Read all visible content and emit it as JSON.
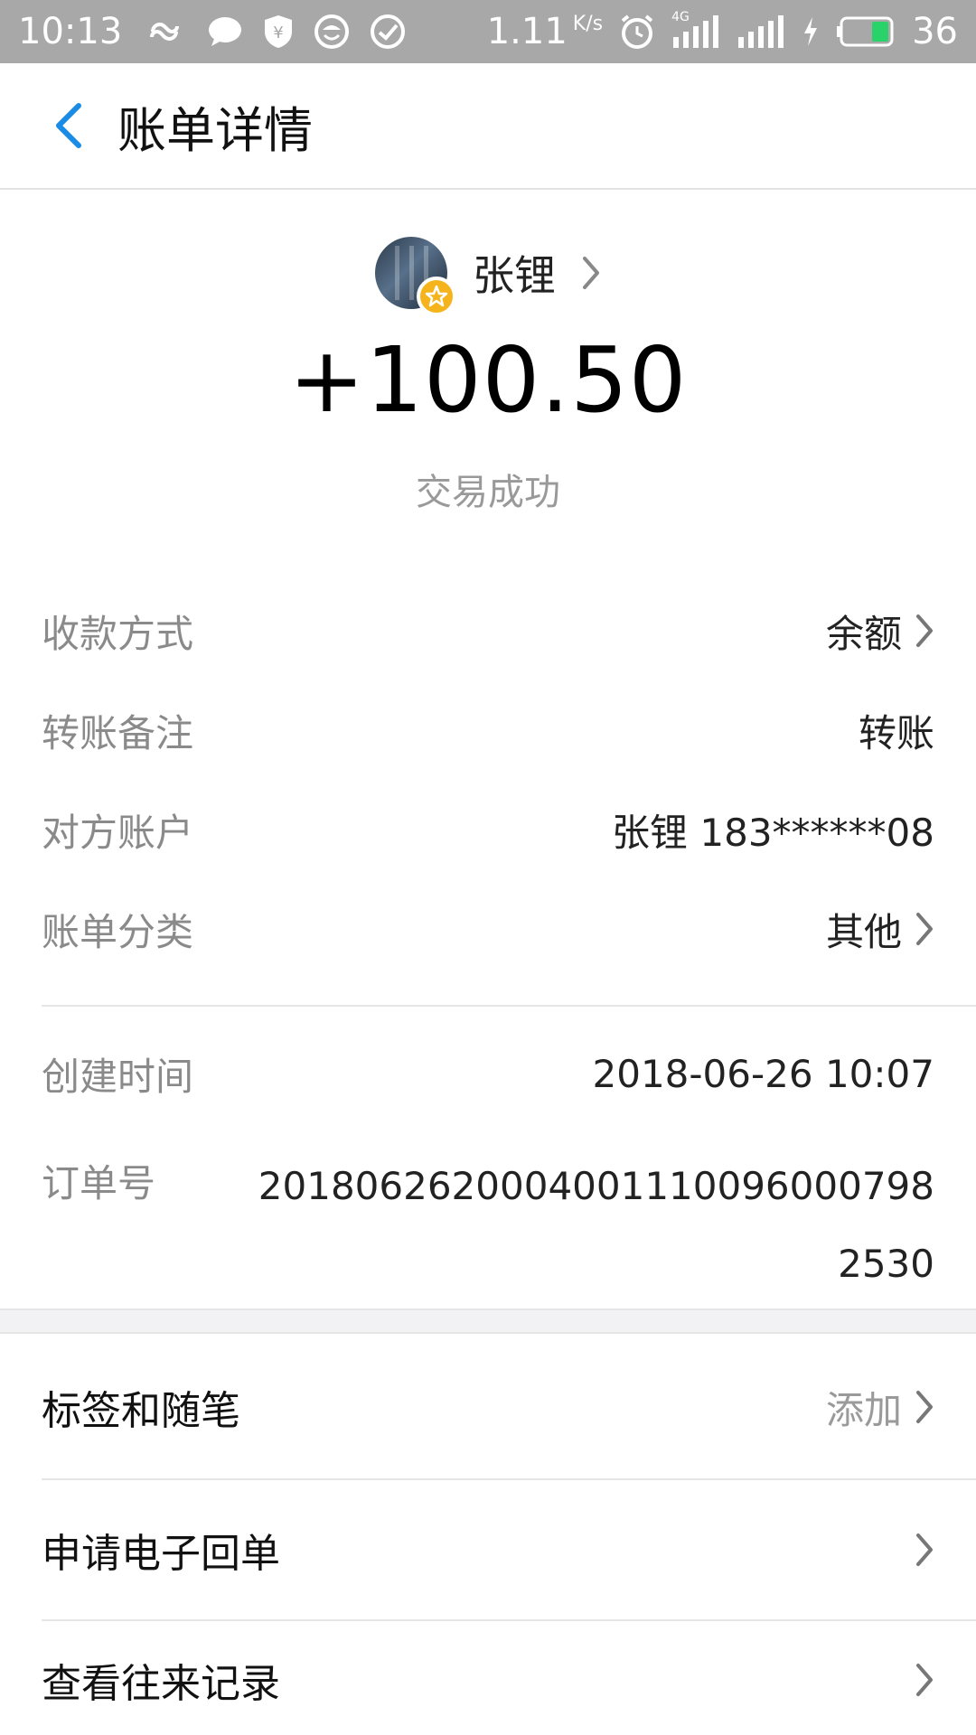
{
  "status_bar": {
    "time": "10:13",
    "speed": "1.11",
    "speed_unit": "K/s",
    "network": "4G",
    "battery": "36"
  },
  "header": {
    "title": "账单详情"
  },
  "summary": {
    "payee_name": "张锂",
    "amount": "+100.50",
    "status": "交易成功"
  },
  "details": [
    {
      "label": "收款方式",
      "value": "余额"
    },
    {
      "label": "转账备注",
      "value": "转账"
    },
    {
      "label": "对方账户",
      "value": "张锂 183******08"
    },
    {
      "label": "账单分类",
      "value": "其他"
    }
  ],
  "created": {
    "label": "创建时间",
    "value": "2018-06-26 10:07"
  },
  "order": {
    "label": "订单号",
    "value": "2018062620004001110096000798 2530"
  },
  "menu": [
    {
      "label": "标签和随笔",
      "value": "添加"
    },
    {
      "label": "申请电子回单",
      "value": ""
    },
    {
      "label": "查看往来记录",
      "value": ""
    }
  ],
  "colors": {
    "accent": "#1a8ce6",
    "status_bar": "#a8a8a8",
    "badge": "#f6b41c",
    "battery": "#29d36a"
  }
}
